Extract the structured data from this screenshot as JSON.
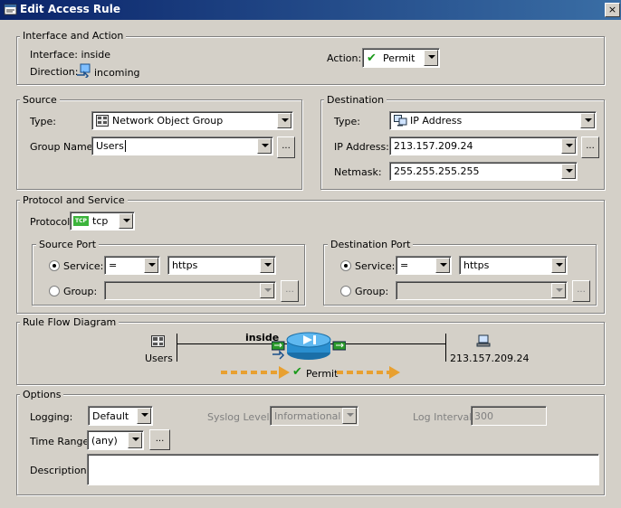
{
  "window": {
    "title": "Edit Access Rule",
    "close_label": "×"
  },
  "interface_action": {
    "legend": "Interface and Action",
    "interface_text": "Interface: inside",
    "direction_label": "Direction:",
    "direction_value": "incoming",
    "action_label": "Action:",
    "action_value": "Permit"
  },
  "source": {
    "legend": "Source",
    "type_label": "Type:",
    "type_value": "Network Object Group",
    "group_name_label": "Group Name:",
    "group_name_value": "Users",
    "browse_label": "..."
  },
  "destination": {
    "legend": "Destination",
    "type_label": "Type:",
    "type_value": "IP Address",
    "ip_label": "IP Address:",
    "ip_value": "213.157.209.24",
    "netmask_label": "Netmask:",
    "netmask_value": "255.255.255.255",
    "browse_label": "..."
  },
  "protocol": {
    "legend": "Protocol and Service",
    "protocol_label": "Protocol:",
    "protocol_value": "tcp",
    "protocol_icon_text": "TCP",
    "source_port": {
      "legend": "Source Port",
      "service_label": "Service:",
      "operator": "=",
      "service_value": "https",
      "group_label": "Group:",
      "browse_label": "..."
    },
    "dest_port": {
      "legend": "Destination Port",
      "service_label": "Service:",
      "operator": "=",
      "service_value": "https",
      "group_label": "Group:",
      "browse_label": "..."
    }
  },
  "flow": {
    "legend": "Rule Flow Diagram",
    "source_label": "Users",
    "interface_label": "inside",
    "dest_label": "213.157.209.24",
    "action_label": "Permit",
    "arrow_color": "#e8a030",
    "router_color": "#2a8fd0"
  },
  "options": {
    "legend": "Options",
    "logging_label": "Logging:",
    "logging_value": "Default",
    "syslog_label": "Syslog Level:",
    "syslog_value": "Informational",
    "interval_label": "Log Interval:",
    "interval_value": "300",
    "time_range_label": "Time Range:",
    "time_range_value": "(any)",
    "browse_label": "...",
    "description_label": "Description:",
    "description_value": ""
  }
}
